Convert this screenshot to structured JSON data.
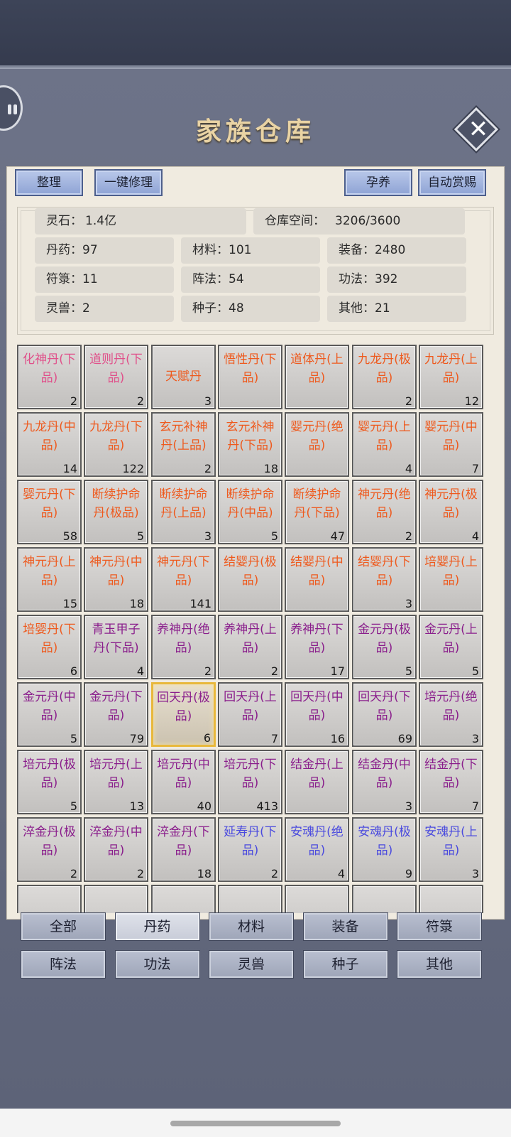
{
  "header": {
    "title": "家族仓库",
    "close_icon": "close-icon",
    "side_icon": "pause-icon"
  },
  "toolbar": {
    "sort_label": "整理",
    "repair_label": "一键修理",
    "nurture_label": "孕养",
    "auto_reward_label": "自动赏赐"
  },
  "stats": {
    "spirit_stone": {
      "key": "灵石：",
      "value": "1.4亿"
    },
    "storage_space": {
      "key": "仓库空间：",
      "value": "3206/3600"
    },
    "pills": {
      "key": "丹药：",
      "value": "97"
    },
    "materials": {
      "key": "材料：",
      "value": "101"
    },
    "equipment": {
      "key": "装备：",
      "value": "2480"
    },
    "talismans": {
      "key": "符箓：",
      "value": "11"
    },
    "formations": {
      "key": "阵法：",
      "value": "54"
    },
    "techniques": {
      "key": "功法：",
      "value": "392"
    },
    "beasts": {
      "key": "灵兽：",
      "value": "2"
    },
    "seeds": {
      "key": "种子：",
      "value": "48"
    },
    "others": {
      "key": "其他：",
      "value": "21"
    }
  },
  "colors": {
    "pink": "#e0508a",
    "orange": "#ee5a1e",
    "purple": "#8a1e8c",
    "blue": "#4a4ade"
  },
  "items": [
    {
      "name": "化神丹(下品)",
      "count": "2",
      "color": "pink"
    },
    {
      "name": "道则丹(下品)",
      "count": "2",
      "color": "pink"
    },
    {
      "name": "天赋丹",
      "count": "3",
      "color": "orange"
    },
    {
      "name": "悟性丹(下品)",
      "count": "",
      "color": "orange"
    },
    {
      "name": "道体丹(上品)",
      "count": "",
      "color": "orange"
    },
    {
      "name": "九龙丹(极品)",
      "count": "2",
      "color": "orange"
    },
    {
      "name": "九龙丹(上品)",
      "count": "12",
      "color": "orange"
    },
    {
      "name": "九龙丹(中品)",
      "count": "14",
      "color": "orange"
    },
    {
      "name": "九龙丹(下品)",
      "count": "122",
      "color": "orange"
    },
    {
      "name": "玄元补神丹(上品)",
      "count": "2",
      "color": "orange"
    },
    {
      "name": "玄元补神丹(下品)",
      "count": "18",
      "color": "orange"
    },
    {
      "name": "婴元丹(绝品)",
      "count": "",
      "color": "orange"
    },
    {
      "name": "婴元丹(上品)",
      "count": "4",
      "color": "orange"
    },
    {
      "name": "婴元丹(中品)",
      "count": "7",
      "color": "orange"
    },
    {
      "name": "婴元丹(下品)",
      "count": "58",
      "color": "orange"
    },
    {
      "name": "断续护命丹(极品)",
      "count": "5",
      "color": "orange"
    },
    {
      "name": "断续护命丹(上品)",
      "count": "3",
      "color": "orange"
    },
    {
      "name": "断续护命丹(中品)",
      "count": "5",
      "color": "orange"
    },
    {
      "name": "断续护命丹(下品)",
      "count": "47",
      "color": "orange"
    },
    {
      "name": "神元丹(绝品)",
      "count": "2",
      "color": "orange"
    },
    {
      "name": "神元丹(极品)",
      "count": "4",
      "color": "orange"
    },
    {
      "name": "神元丹(上品)",
      "count": "15",
      "color": "orange"
    },
    {
      "name": "神元丹(中品)",
      "count": "18",
      "color": "orange"
    },
    {
      "name": "神元丹(下品)",
      "count": "141",
      "color": "orange"
    },
    {
      "name": "结婴丹(极品)",
      "count": "",
      "color": "orange"
    },
    {
      "name": "结婴丹(中品)",
      "count": "",
      "color": "orange"
    },
    {
      "name": "结婴丹(下品)",
      "count": "3",
      "color": "orange"
    },
    {
      "name": "培婴丹(上品)",
      "count": "",
      "color": "orange"
    },
    {
      "name": "培婴丹(下品)",
      "count": "6",
      "color": "orange"
    },
    {
      "name": "青玉甲子丹(下品)",
      "count": "4",
      "color": "purple"
    },
    {
      "name": "养神丹(绝品)",
      "count": "2",
      "color": "purple"
    },
    {
      "name": "养神丹(上品)",
      "count": "2",
      "color": "purple"
    },
    {
      "name": "养神丹(下品)",
      "count": "17",
      "color": "purple"
    },
    {
      "name": "金元丹(极品)",
      "count": "5",
      "color": "purple"
    },
    {
      "name": "金元丹(上品)",
      "count": "5",
      "color": "purple"
    },
    {
      "name": "金元丹(中品)",
      "count": "5",
      "color": "purple"
    },
    {
      "name": "金元丹(下品)",
      "count": "79",
      "color": "purple"
    },
    {
      "name": "回天丹(极品)",
      "count": "6",
      "color": "purple",
      "selected": true
    },
    {
      "name": "回天丹(上品)",
      "count": "7",
      "color": "purple"
    },
    {
      "name": "回天丹(中品)",
      "count": "16",
      "color": "purple"
    },
    {
      "name": "回天丹(下品)",
      "count": "69",
      "color": "purple"
    },
    {
      "name": "培元丹(绝品)",
      "count": "3",
      "color": "purple"
    },
    {
      "name": "培元丹(极品)",
      "count": "5",
      "color": "purple"
    },
    {
      "name": "培元丹(上品)",
      "count": "13",
      "color": "purple"
    },
    {
      "name": "培元丹(中品)",
      "count": "40",
      "color": "purple"
    },
    {
      "name": "培元丹(下品)",
      "count": "413",
      "color": "purple"
    },
    {
      "name": "结金丹(上品)",
      "count": "",
      "color": "purple"
    },
    {
      "name": "结金丹(中品)",
      "count": "3",
      "color": "purple"
    },
    {
      "name": "结金丹(下品)",
      "count": "7",
      "color": "purple"
    },
    {
      "name": "淬金丹(极品)",
      "count": "2",
      "color": "purple"
    },
    {
      "name": "淬金丹(中品)",
      "count": "2",
      "color": "purple"
    },
    {
      "name": "淬金丹(下品)",
      "count": "18",
      "color": "purple"
    },
    {
      "name": "延寿丹(下品)",
      "count": "2",
      "color": "blue"
    },
    {
      "name": "安魂丹(绝品)",
      "count": "4",
      "color": "blue"
    },
    {
      "name": "安魂丹(极品)",
      "count": "9",
      "color": "blue"
    },
    {
      "name": "安魂丹(上品)",
      "count": "3",
      "color": "blue"
    },
    {
      "name": "",
      "count": "",
      "color": "blue"
    },
    {
      "name": "",
      "count": "",
      "color": "blue"
    },
    {
      "name": "",
      "count": "",
      "color": "blue"
    },
    {
      "name": "",
      "count": "",
      "color": "blue"
    },
    {
      "name": "",
      "count": "",
      "color": "blue"
    },
    {
      "name": "",
      "count": "",
      "color": "blue"
    },
    {
      "name": "",
      "count": "",
      "color": "blue"
    }
  ],
  "tabs": [
    {
      "label": "全部",
      "active": false
    },
    {
      "label": "丹药",
      "active": true
    },
    {
      "label": "材料",
      "active": false
    },
    {
      "label": "装备",
      "active": false
    },
    {
      "label": "符箓",
      "active": false
    },
    {
      "label": "阵法",
      "active": false
    },
    {
      "label": "功法",
      "active": false
    },
    {
      "label": "灵兽",
      "active": false
    },
    {
      "label": "种子",
      "active": false
    },
    {
      "label": "其他",
      "active": false
    }
  ]
}
